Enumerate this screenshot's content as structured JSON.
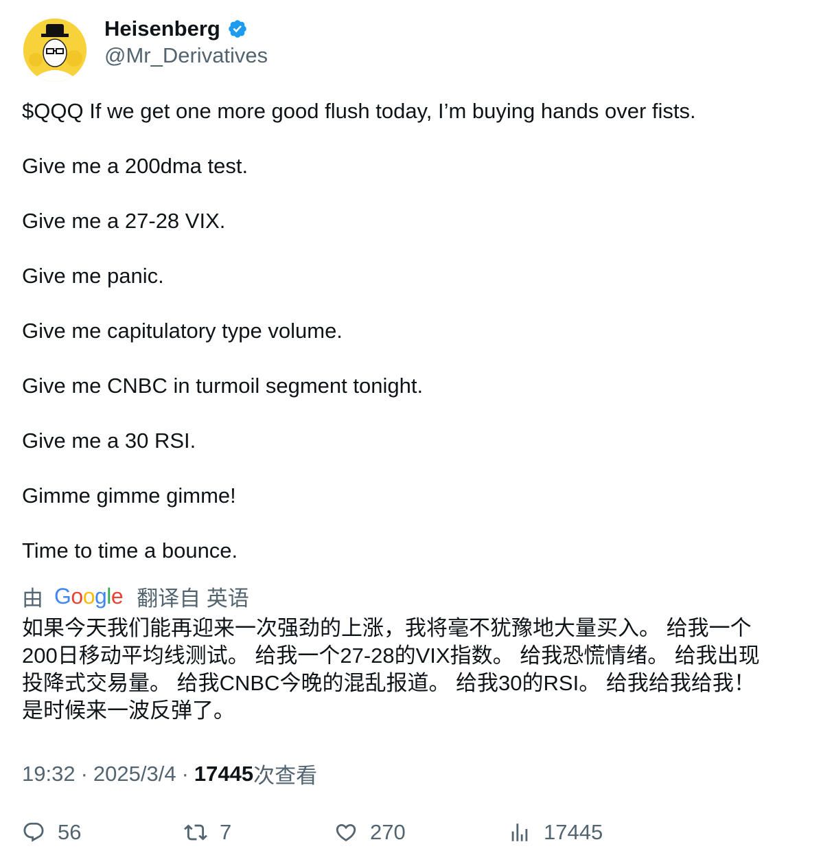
{
  "author": {
    "name": "Heisenberg",
    "handle": "@Mr_Derivatives",
    "verified_icon": "verified-badge-icon",
    "avatar_color": "#f7d23a"
  },
  "tweet": {
    "lines": [
      "$QQQ If we get one more good flush today, I’m buying hands over fists.",
      "Give me a 200dma test.",
      "Give me a 27-28 VIX.",
      "Give me panic.",
      "Give me capitulatory type volume.",
      "Give me CNBC in turmoil segment tonight.",
      "Give me a 30 RSI.",
      "Gimme gimme gimme!",
      "Time to time a bounce."
    ]
  },
  "translation": {
    "by": "由",
    "brand": "Google",
    "translated_from": "翻译自 英语",
    "lines": [
      "如果今天我们能再迎来一次强劲的上涨，我将毫不犹豫地大量买入。 给我一个",
      "200日移动平均线测试。 给我一个27-28的VIX指数。 给我恐慌情绪。 给我出现",
      "投降式交易量。 给我CNBC今晚的混乱报道。 给我30的RSI。 给我给我给我！",
      "是时候来一波反弹了。"
    ]
  },
  "meta": {
    "time": "19:32",
    "separator": "·",
    "date": "2025/3/4",
    "views_count": "17445",
    "views_label": "次查看"
  },
  "actions": {
    "replies": "56",
    "retweets": "7",
    "likes": "270",
    "views": "17445"
  },
  "colors": {
    "text": "#0f1419",
    "secondary": "#536471",
    "verified": "#1d9bf0"
  }
}
